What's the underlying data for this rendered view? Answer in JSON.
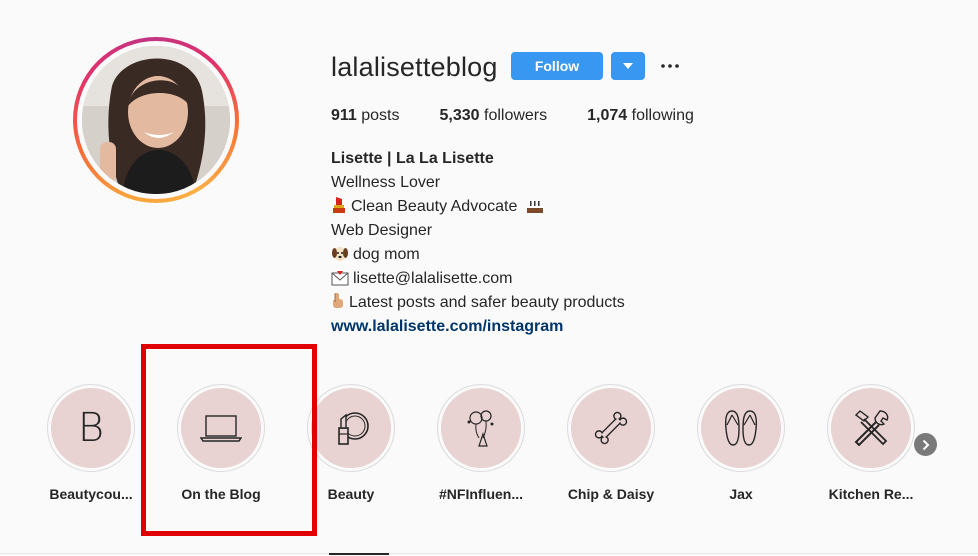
{
  "profile": {
    "username": "lalalisetteblog",
    "follow_label": "Follow",
    "more_label": "···"
  },
  "stats": {
    "posts_count": "911",
    "posts_label": " posts",
    "followers_count": "5,330",
    "followers_label": " followers",
    "following_count": "1,074",
    "following_label": " following"
  },
  "bio": {
    "name": "Lisette | La La Lisette",
    "line1": "Wellness Lover",
    "line2": "Clean Beauty Advocate",
    "line3": "Web Designer",
    "line4": "dog mom",
    "line5": "lisette@lalalisette.com",
    "line6": "Latest posts and safer beauty products",
    "link": "www.lalalisette.com/instagram"
  },
  "highlights": [
    {
      "label": "Beautycou...",
      "icon": "letter-b",
      "letter": "B"
    },
    {
      "label": "On the Blog",
      "icon": "laptop-icon"
    },
    {
      "label": "Beauty",
      "icon": "mirror-lipstick-icon"
    },
    {
      "label": "#NFInfluen...",
      "icon": "balloons-icon"
    },
    {
      "label": "Chip & Daisy",
      "icon": "bone-icon"
    },
    {
      "label": "Jax",
      "icon": "flip-flops-icon"
    },
    {
      "label": "Kitchen Re...",
      "icon": "tools-icon"
    }
  ],
  "colors": {
    "follow_blue": "#3897f0",
    "highlight_bg": "#e8d2d2",
    "link_color": "#003569",
    "annotation_red": "#e00000"
  }
}
